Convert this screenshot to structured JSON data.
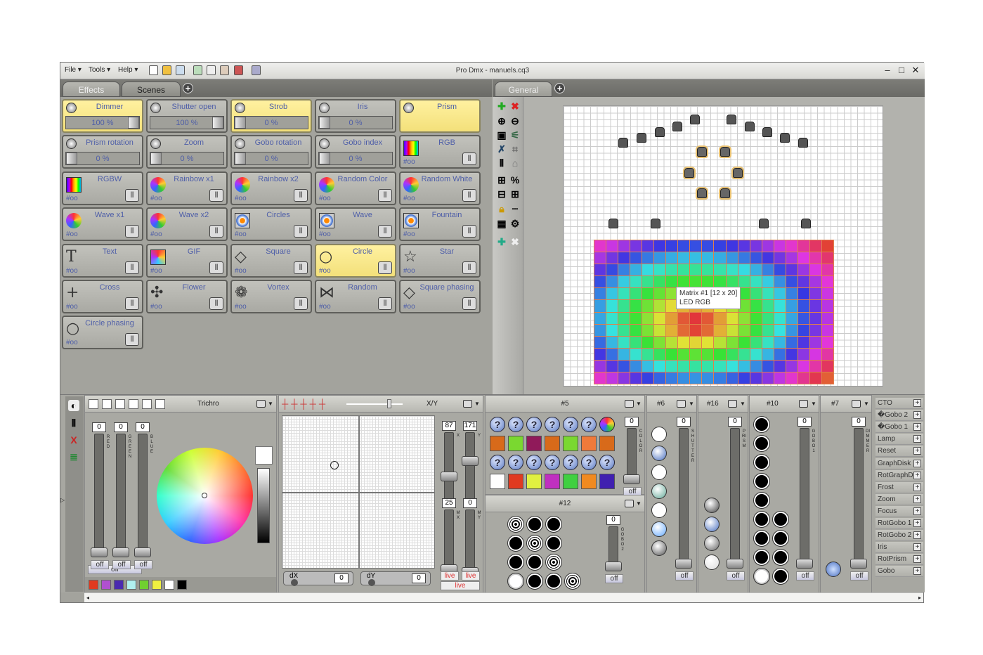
{
  "window": {
    "title": "Pro Dmx - manuels.cq3"
  },
  "menu": {
    "file": "File",
    "tools": "Tools",
    "help": "Help"
  },
  "toolbar_icons": [
    "new-file-icon",
    "open-folder-icon",
    "save-icon",
    "import-icon",
    "export-icon",
    "upload-icon",
    "binoculars-icon",
    "chart-icon"
  ],
  "left_tabs": [
    "Effects",
    "Scenes"
  ],
  "right_tabs": [
    "General"
  ],
  "effects": [
    {
      "label": "Dimmer",
      "active": true,
      "value": "100 %",
      "fill": 100
    },
    {
      "label": "Shutter open",
      "active": false,
      "value": "100 %",
      "fill": 100
    },
    {
      "label": "Strob",
      "active": true,
      "value": "0 %",
      "fill": 0
    },
    {
      "label": "Iris",
      "active": false,
      "value": "0 %",
      "fill": 0
    },
    {
      "label": "Prism",
      "active": true
    },
    {
      "label": "Prism rotation",
      "active": false,
      "value": "0 %",
      "fill": 0
    },
    {
      "label": "Zoom",
      "active": false,
      "value": "0 %",
      "fill": 0
    },
    {
      "label": "Gobo rotation",
      "active": false,
      "value": "0 %",
      "fill": 0
    },
    {
      "label": "Gobo index",
      "active": false,
      "value": "0 %",
      "fill": 0
    },
    {
      "label": "RGB",
      "active": false,
      "icon": "rainbow-bars"
    },
    {
      "label": "RGBW",
      "active": false,
      "icon": "rainbow-bars"
    },
    {
      "label": "Rainbow x1",
      "active": false,
      "icon": "recycle"
    },
    {
      "label": "Rainbow x2",
      "active": false,
      "icon": "recycle"
    },
    {
      "label": "Random Color",
      "active": false,
      "icon": "recycle"
    },
    {
      "label": "Random White",
      "active": false,
      "icon": "recycle"
    },
    {
      "label": "Wave x1",
      "active": false,
      "icon": "recycle"
    },
    {
      "label": "Wave x2",
      "active": false,
      "icon": "recycle"
    },
    {
      "label": "Circles",
      "active": false,
      "icon": "target"
    },
    {
      "label": "Wave",
      "active": false,
      "icon": "target"
    },
    {
      "label": "Fountain",
      "active": false,
      "icon": "target"
    },
    {
      "label": "Text",
      "active": false,
      "icon": "T"
    },
    {
      "label": "GIF",
      "active": false,
      "icon": "spiral"
    },
    {
      "label": "Square",
      "active": false,
      "icon": "◇"
    },
    {
      "label": "Circle",
      "active": true,
      "icon": "○"
    },
    {
      "label": "Star",
      "active": false,
      "icon": "☆"
    },
    {
      "label": "Cross",
      "active": false,
      "icon": "+"
    },
    {
      "label": "Flower",
      "active": false,
      "icon": "✣"
    },
    {
      "label": "Vortex",
      "active": false,
      "icon": "❁"
    },
    {
      "label": "Random",
      "active": false,
      "icon": "⋈"
    },
    {
      "label": "Square phasing",
      "active": false,
      "icon": "◇"
    },
    {
      "label": "Circle phasing",
      "active": false,
      "icon": "○"
    }
  ],
  "effect_hash": "oo",
  "matrix_tooltip": {
    "line1": "Matrix #1 [12 x 20]",
    "line2": "LED RGB"
  },
  "trichro": {
    "title": "Trichro",
    "channels": [
      {
        "label": "RED",
        "value": "0",
        "off": "off"
      },
      {
        "label": "GREEN",
        "value": "0",
        "off": "off"
      },
      {
        "label": "BLUE",
        "value": "0",
        "off": "off"
      }
    ],
    "all_off": "off",
    "swatches": [
      "#e03a20",
      "#b050d0",
      "#4a2ab0",
      "#b0f0f0",
      "#70d030",
      "#f0f040",
      "#ffffff",
      "#000000"
    ]
  },
  "xy": {
    "title": "X/Y",
    "x": {
      "label": "X",
      "value": "87"
    },
    "y": {
      "label": "Y",
      "value": "171"
    },
    "mx": {
      "label": "MX",
      "value": "25"
    },
    "my": {
      "label": "MY",
      "value": "0"
    },
    "dx": {
      "label": "dX",
      "value": "0"
    },
    "dy": {
      "label": "dY",
      "value": "0"
    },
    "live": "live"
  },
  "panel5": {
    "title": "#5",
    "slider_label": "COLOR",
    "value": "0",
    "off": "off",
    "colors_row1": [
      "#d86a1a",
      "#7ad830",
      "#901a5a",
      "#d86a1a",
      "#7ad830",
      "#f07a3a",
      "#d86a1a"
    ],
    "colors_row2": [
      "#ffffff",
      "#e03a20",
      "#e0f040",
      "#c030c0",
      "#40d040",
      "#f08a20",
      "#4020b0"
    ]
  },
  "panel12": {
    "title": "#12",
    "slider_label": "GOBO 2",
    "value": "0",
    "off": "off"
  },
  "panel6": {
    "title": "#6",
    "slider_label": "SHUTTER",
    "value": "0",
    "off": "off"
  },
  "panel16": {
    "title": "#16",
    "slider_label": "PRISM",
    "value": "0",
    "off": "off"
  },
  "panel10": {
    "title": "#10",
    "slider_label": "GOBO 1",
    "value": "0",
    "off": "off"
  },
  "panel7": {
    "title": "#7",
    "slider_label": "DIMMER",
    "value": "0",
    "off": "off"
  },
  "channel_list": [
    "CTO",
    "�Gobo 2",
    "�Gobo 1",
    "Lamp",
    "Reset",
    "GraphDisk",
    "RotGraphD",
    "Frost",
    "Zoom",
    "Focus",
    "RotGobo 1",
    "RotGobo 2",
    "Iris",
    "RotPrism",
    "Gobo"
  ],
  "colors": {
    "active_tile": "#f3e07a",
    "label_text": "#4e5ea8",
    "live_text": "#dd3333"
  }
}
